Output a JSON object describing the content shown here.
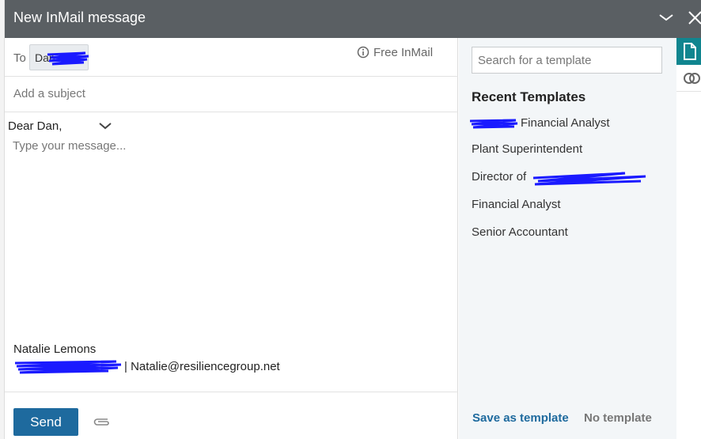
{
  "window": {
    "title": "New InMail message"
  },
  "recipient": {
    "to_label": "To",
    "chip_text": "Dan"
  },
  "free_inmail": {
    "label": "Free InMail"
  },
  "subject": {
    "placeholder": "Add a subject"
  },
  "body": {
    "greeting": "Dear Dan,",
    "placeholder": "Type your message...",
    "signature_name": "Natalie Lemons",
    "signature_email": "| Natalie@resiliencegroup.net"
  },
  "footer": {
    "send_label": "Send"
  },
  "templates": {
    "search_placeholder": "Search for a template",
    "recent_title": "Recent Templates",
    "items": [
      {
        "label": "Financial Analyst"
      },
      {
        "label": "Plant Superintendent"
      },
      {
        "label": "Director of"
      },
      {
        "label": "Financial Analyst"
      },
      {
        "label": "Senior Accountant"
      }
    ],
    "save_label": "Save as template",
    "none_label": "No template"
  },
  "colors": {
    "header_bg": "#5a5f63",
    "accent": "#1e6a9e",
    "rail_active": "#10858f",
    "redaction": "#1a1aff"
  },
  "icons": [
    "chevron-down-icon",
    "close-icon",
    "info-icon",
    "paperclip-icon",
    "document-icon",
    "overlap-circles-icon"
  ]
}
